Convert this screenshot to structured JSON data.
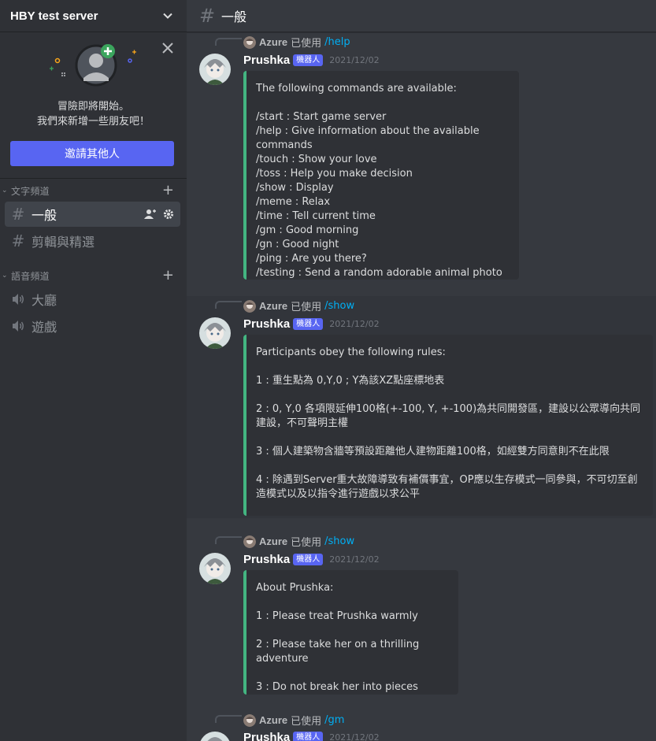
{
  "server": {
    "name": "HBY test server"
  },
  "welcome": {
    "line1": "冒險即將開始。",
    "line2": "我們來新增一些朋友吧！",
    "invite_label": "邀請其他人"
  },
  "categories": [
    {
      "label": "文字頻道",
      "channels": [
        "一般",
        "剪輯與精選"
      ]
    },
    {
      "label": "語音頻道",
      "channels": [
        "大廳",
        "遊戲"
      ]
    }
  ],
  "topbar": {
    "channel": "一般"
  },
  "messages": [
    {
      "reply_user": "Azure",
      "reply_used": "已使用",
      "reply_cmd": "/help",
      "author": "Prushka",
      "bot_tag": "機器人",
      "timestamp": "2021/12/02",
      "embed": "The following commands are available:\n\n/start : Start game server\n/help : Give information about the available commands\n/touch : Show your love\n/toss : Help you make decision\n/show : Display\n/meme : Relax\n/time : Tell current time\n/gm : Good morning\n/gn : Good night\n/ping : Are you there?\n/testing : Send a random adorable animal photo"
    },
    {
      "reply_user": "Azure",
      "reply_used": "已使用",
      "reply_cmd": "/show",
      "author": "Prushka",
      "bot_tag": "機器人",
      "timestamp": "2021/12/02",
      "embed": "Participants obey the following rules:\n\n1 : 重生點為 0,Y,0 ; Y為該XZ點座標地表\n\n2 : 0, Y,0 各項限延伸100格(+-100, Y, +-100)為共同開發區，建設以公眾導向共同建設，不可聲明主權\n\n3 : 個人建築物含牆等預設距離他人建物距離100格，如經雙方同意則不在此限\n\n4 : 除遇到Server重大故障導致有補償事宜，OP應以生存模式一同參與，不可切至創造模式以及以指令進行遊戲以求公平"
    },
    {
      "reply_user": "Azure",
      "reply_used": "已使用",
      "reply_cmd": "/show",
      "author": "Prushka",
      "bot_tag": "機器人",
      "timestamp": "2021/12/02",
      "embed": "About Prushka:\n\n1 : Please treat Prushka warmly\n\n2 : Please take her on a thrilling adventure\n\n3 : Do not break her into pieces"
    },
    {
      "reply_user": "Azure",
      "reply_used": "已使用",
      "reply_cmd": "/gm",
      "author": "Prushka",
      "bot_tag": "機器人",
      "timestamp": "2021/12/02"
    }
  ],
  "colors": {
    "accent": "#5865f2",
    "embed_bar": "#43b581",
    "link": "#00aff4",
    "online": "#3ba55d"
  }
}
